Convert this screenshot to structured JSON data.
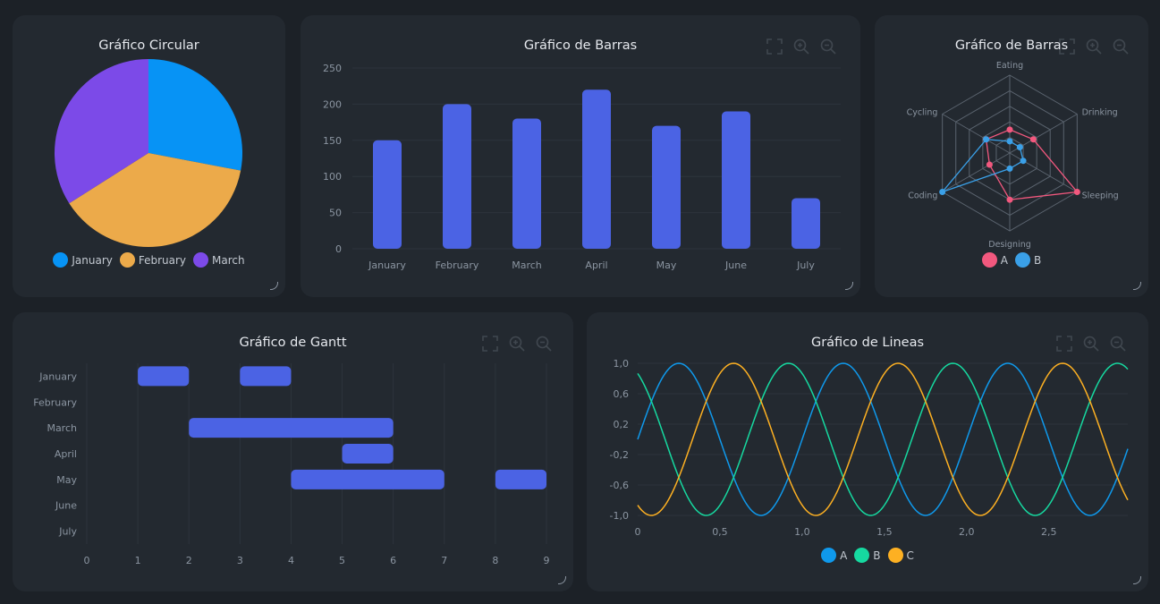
{
  "colors": {
    "background": "#1c2127",
    "panel": "#232930",
    "bar": "#4b63e4",
    "grid": "#2d343c",
    "axis_text": "#8b95a1",
    "A": "#0f99ec",
    "B": "#16d9a0",
    "C": "#fdb022",
    "radarA": "#f2587e",
    "radarB": "#3aa0e8"
  },
  "toolbar_icons": [
    "fullscreen-icon",
    "zoom-in-icon",
    "zoom-out-icon"
  ],
  "pie": {
    "title": "Gráfico Circular",
    "chart_data": {
      "type": "pie",
      "labels": [
        "January",
        "February",
        "March"
      ],
      "values": [
        28,
        38,
        34
      ],
      "colors": [
        "#0793f5",
        "#ecaa4a",
        "#7c4ae8"
      ]
    }
  },
  "bar": {
    "title": "Gráfico de Barras",
    "chart_data": {
      "type": "bar",
      "categories": [
        "January",
        "February",
        "March",
        "April",
        "May",
        "June",
        "July"
      ],
      "values": [
        150,
        200,
        180,
        220,
        170,
        190,
        70
      ],
      "ylim": [
        0,
        250
      ],
      "yticks": [
        "0",
        "50",
        "100",
        "150",
        "200",
        "250"
      ]
    }
  },
  "radar": {
    "title": "Gráfico de Barras",
    "chart_data": {
      "type": "radar",
      "axes": [
        "Eating",
        "Drinking",
        "Sleeping",
        "Designing",
        "Coding",
        "Cycling"
      ],
      "max": 100,
      "series": [
        {
          "name": "A",
          "values": [
            30,
            35,
            100,
            60,
            30,
            35
          ],
          "color": "#f2587e"
        },
        {
          "name": "B",
          "values": [
            15,
            15,
            20,
            20,
            100,
            35
          ],
          "color": "#3aa0e8"
        }
      ]
    }
  },
  "gantt": {
    "title": "Gráfico de Gantt",
    "chart_data": {
      "type": "gantt",
      "categories": [
        "January",
        "February",
        "March",
        "April",
        "May",
        "June",
        "July"
      ],
      "xlim": [
        0,
        9
      ],
      "xticks": [
        "0",
        "1",
        "2",
        "3",
        "4",
        "5",
        "6",
        "7",
        "8",
        "9"
      ],
      "tasks": [
        {
          "row": "January",
          "start": 1,
          "end": 2
        },
        {
          "row": "January",
          "start": 3,
          "end": 4
        },
        {
          "row": "March",
          "start": 2,
          "end": 6
        },
        {
          "row": "April",
          "start": 5,
          "end": 6
        },
        {
          "row": "May",
          "start": 4,
          "end": 7
        },
        {
          "row": "May",
          "start": 8,
          "end": 9
        }
      ]
    }
  },
  "line": {
    "title": "Gráfico de Lineas",
    "chart_data": {
      "type": "line",
      "xlim": [
        0,
        2.98
      ],
      "ylim": [
        -1,
        1
      ],
      "xticks": [
        {
          "v": 0,
          "label": "0"
        },
        {
          "v": 0.5,
          "label": "0,5"
        },
        {
          "v": 1,
          "label": "1,0"
        },
        {
          "v": 1.5,
          "label": "1,5"
        },
        {
          "v": 2,
          "label": "2,0"
        },
        {
          "v": 2.5,
          "label": "2,5"
        }
      ],
      "yticks": [
        {
          "v": 1,
          "label": "1,0"
        },
        {
          "v": 0.6,
          "label": "0,6"
        },
        {
          "v": 0.2,
          "label": "0,2"
        },
        {
          "v": -0.2,
          "label": "-0,2"
        },
        {
          "v": -0.6,
          "label": "-0,6"
        },
        {
          "v": -1,
          "label": "-1,0"
        }
      ],
      "series": [
        {
          "name": "A",
          "function": "sin(2·π·x)",
          "amplitude": 1,
          "period": 1,
          "phase_deg": 0,
          "color": "#0f99ec"
        },
        {
          "name": "B",
          "function": "sin(2·π·x + 120°)",
          "amplitude": 1,
          "period": 1,
          "phase_deg": 120,
          "color": "#16d9a0"
        },
        {
          "name": "C",
          "function": "sin(2·π·x + 240°)",
          "amplitude": 1,
          "period": 1,
          "phase_deg": 240,
          "color": "#fdb022"
        }
      ]
    }
  }
}
